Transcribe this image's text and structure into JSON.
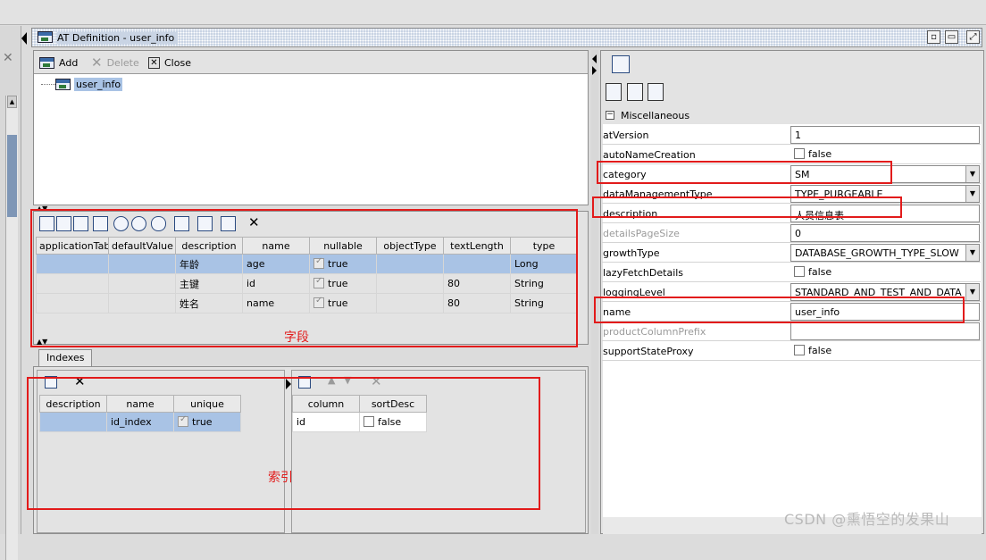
{
  "window": {
    "title": "AT Definition - user_info"
  },
  "tree_toolbar": {
    "add_label": "Add",
    "delete_label": "Delete",
    "close_label": "Close"
  },
  "tree": {
    "node_label": "user_info"
  },
  "fields_table": {
    "columns": [
      "applicationTable",
      "defaultValue",
      "description",
      "name",
      "nullable",
      "objectType",
      "textLength",
      "type"
    ],
    "rows": [
      {
        "applicationTable": "",
        "defaultValue": "",
        "description": "年龄",
        "name": "age",
        "nullable": "true",
        "objectType": "",
        "textLength": "",
        "type": "Long"
      },
      {
        "applicationTable": "",
        "defaultValue": "",
        "description": "主键",
        "name": "id",
        "nullable": "true",
        "objectType": "",
        "textLength": "80",
        "type": "String"
      },
      {
        "applicationTable": "",
        "defaultValue": "",
        "description": "姓名",
        "name": "name",
        "nullable": "true",
        "objectType": "",
        "textLength": "80",
        "type": "String"
      }
    ],
    "annotation": "字段"
  },
  "indexes": {
    "tab_label": "Indexes",
    "left_columns": [
      "description",
      "name",
      "unique"
    ],
    "left_rows": [
      {
        "description": "",
        "name": "id_index",
        "unique": "true"
      }
    ],
    "right_columns": [
      "column",
      "sortDesc"
    ],
    "right_rows": [
      {
        "column": "id",
        "sortDesc": "false"
      }
    ],
    "annotation": "索引"
  },
  "properties": {
    "section_label": "Miscellaneous",
    "rows": [
      {
        "name": "atVersion",
        "value": "1"
      },
      {
        "name": "autoNameCreation",
        "value": "false"
      },
      {
        "name": "category",
        "value": "SM"
      },
      {
        "name": "dataManagementType",
        "value": "TYPE_PURGEABLE"
      },
      {
        "name": "description",
        "value": "人员信息表"
      },
      {
        "name": "detailsPageSize",
        "value": "0"
      },
      {
        "name": "growthType",
        "value": "DATABASE_GROWTH_TYPE_SLOW"
      },
      {
        "name": "lazyFetchDetails",
        "value": "false"
      },
      {
        "name": "loggingLevel",
        "value": "STANDARD_AND_TEST_AND_DATA"
      },
      {
        "name": "name",
        "value": "user_info"
      },
      {
        "name": "productColumnPrefix",
        "value": ""
      },
      {
        "name": "supportStateProxy",
        "value": "false"
      }
    ]
  },
  "watermark": "CSDN @熏悟空的发果山"
}
